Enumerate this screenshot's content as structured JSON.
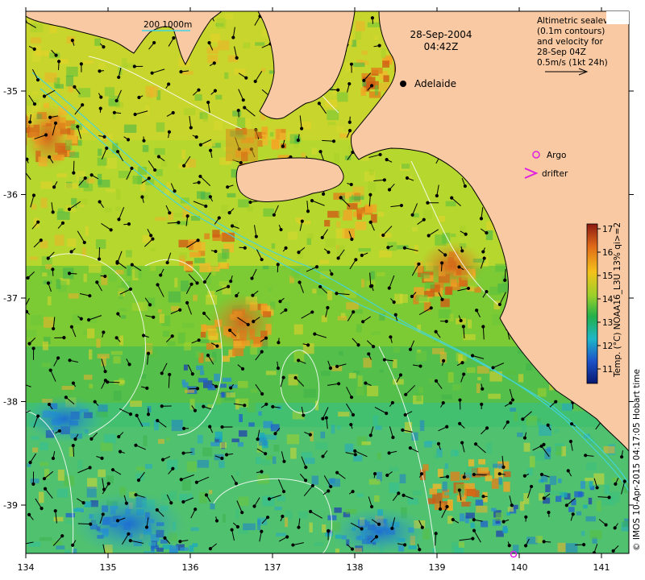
{
  "map": {
    "date": "28-Sep-2004",
    "time": "04:42Z",
    "city": "Adelaide",
    "scale_label": "200 1000m",
    "info_lines": [
      "Altimetric sealevel",
      "(0.1m contours)",
      "and velocity for",
      "28-Sep 04Z",
      "0.5m/s (1kt 24h)"
    ],
    "legend": {
      "argo": "Argo",
      "drifter": "drifter"
    },
    "colorbar": {
      "ticks": [
        "17",
        "16",
        "15",
        "14",
        "13",
        "12",
        "11"
      ],
      "label": "Temp. (°C) NOAA16_L3U 13% qi>=2"
    },
    "credit": "© IMOS 10-Apr-2015 04:17:05 Hobart time",
    "x_ticks": [
      "134",
      "135",
      "136",
      "137",
      "138",
      "139",
      "140",
      "141"
    ],
    "y_ticks": [
      "-35",
      "-36",
      "-37",
      "-38",
      "-39"
    ],
    "colors": {
      "land": "#F8C9A2",
      "ocean_mid": "#7ccf2c",
      "warm": "#e07a18",
      "cool": "#2fbf9a"
    }
  }
}
